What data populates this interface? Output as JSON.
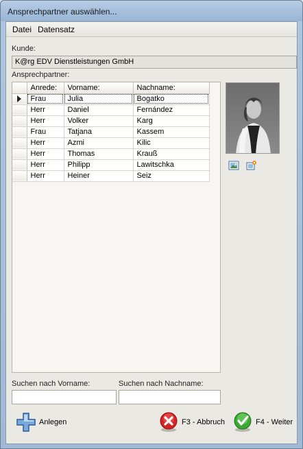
{
  "window": {
    "title": "Ansprechpartner auswählen..."
  },
  "menu": [
    {
      "label": "Datei"
    },
    {
      "label": "Datensatz"
    }
  ],
  "kunde": {
    "label": "Kunde:",
    "value": "K@rg EDV Dienstleistungen GmbH"
  },
  "contacts": {
    "label": "Ansprechpartner:",
    "columns": [
      "Anrede:",
      "Vorname:",
      "Nachname:"
    ],
    "rows": [
      [
        "Frau",
        "Julia",
        "Bogatko"
      ],
      [
        "Herr",
        "Daniel",
        "Fernández"
      ],
      [
        "Herr",
        "Volker",
        "Karg"
      ],
      [
        "Frau",
        "Tatjana",
        "Kassem"
      ],
      [
        "Herr",
        "Azmi",
        "Kilic"
      ],
      [
        "Herr",
        "Thomas",
        "Krauß"
      ],
      [
        "Herr",
        "Philipp",
        "Lawitschka"
      ],
      [
        "Herr",
        "Heiner",
        "Seiz"
      ]
    ]
  },
  "search": {
    "vorname_label": "Suchen nach Vorname:",
    "vorname_value": "",
    "nachname_label": "Suchen nach Nachname:",
    "nachname_value": ""
  },
  "buttons": {
    "anlegen": "Anlegen",
    "abbruch": "F3 - Abbruch",
    "weiter": "F4 - Weiter"
  }
}
